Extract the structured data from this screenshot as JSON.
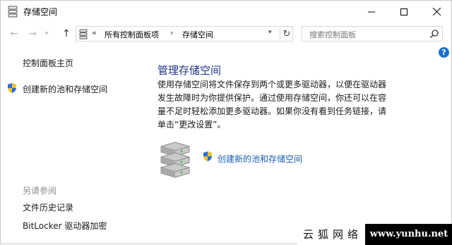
{
  "window": {
    "title": "存储空间"
  },
  "address": {
    "breadcrumb_sep": "«",
    "crumb1": "所有控制面板项",
    "crumb_arrow": "›",
    "crumb2": "存储空间"
  },
  "search": {
    "placeholder": "搜索控制面板"
  },
  "help_label": "?",
  "left_pane": {
    "home": "控制面板主页",
    "create_pool": "创建新的池和存储空间",
    "see_also": "另请参阅",
    "file_history": "文件历史记录",
    "bitlocker": "BitLocker 驱动器加密"
  },
  "main": {
    "title": "管理存储空间",
    "description": "使用存储空间将文件保存到两个或更多驱动器，以便在驱动器发生故障时为你提供保护。通过使用存储空间，你还可以在容量不足时轻松添加更多驱动器。如果你没有看到任务链接，请单击“更改设置”。",
    "create_link": "创建新的池和存储空间"
  },
  "watermark": {
    "left": "云狐网络",
    "right": "www.yunhu.net"
  },
  "colors": {
    "link": "#1a5eb0",
    "heading": "#1e3287",
    "help": "#1a6fd1"
  }
}
